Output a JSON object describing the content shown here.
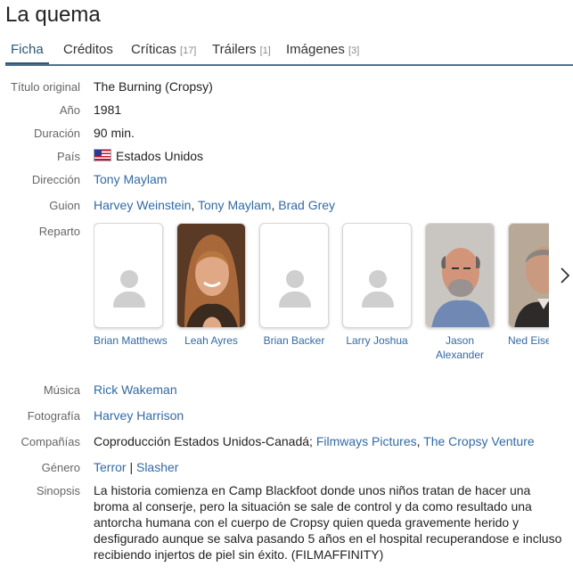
{
  "title": "La quema",
  "tabs": [
    {
      "label": "Ficha",
      "count": ""
    },
    {
      "label": "Créditos",
      "count": ""
    },
    {
      "label": "Críticas",
      "count": "[17]"
    },
    {
      "label": "Tráilers",
      "count": "[1]"
    },
    {
      "label": "Imágenes",
      "count": "[3]"
    }
  ],
  "details": {
    "original_title": {
      "label": "Título original",
      "value": "The Burning (Cropsy)"
    },
    "year": {
      "label": "Año",
      "value": "1981"
    },
    "duration": {
      "label": "Duración",
      "value": "90 min."
    },
    "country": {
      "label": "País",
      "value": "Estados Unidos",
      "flag_icon": "us-flag-icon"
    },
    "direction": {
      "label": "Dirección",
      "names": [
        "Tony Maylam"
      ]
    },
    "script": {
      "label": "Guion",
      "names": [
        "Harvey Weinstein",
        "Tony Maylam",
        "Brad Grey"
      ],
      "separator": ", "
    },
    "cast": {
      "label": "Reparto",
      "members": [
        {
          "name": "Brian Matthews",
          "photo": "placeholder"
        },
        {
          "name": "Leah Ayres",
          "photo": "woman-portrait"
        },
        {
          "name": "Brian Backer",
          "photo": "placeholder"
        },
        {
          "name": "Larry Joshua",
          "photo": "placeholder"
        },
        {
          "name": "Jason Alexander",
          "photo": "man-portrait-bald"
        },
        {
          "name": "Ned Eisenberg",
          "photo": "man-portrait-dark"
        }
      ]
    },
    "music": {
      "label": "Música",
      "names": [
        "Rick Wakeman"
      ]
    },
    "photography": {
      "label": "Fotografía",
      "names": [
        "Harvey Harrison"
      ]
    },
    "companies": {
      "label": "Compañías",
      "plain": "Coproducción Estados Unidos-Canadá; ",
      "names": [
        "Filmways Pictures",
        "The Cropsy Venture"
      ],
      "separator": ", "
    },
    "genre": {
      "label": "Género",
      "names": [
        "Terror",
        "Slasher"
      ],
      "separator": " | "
    },
    "synopsis": {
      "label": "Sinopsis",
      "text": "La historia comienza en Camp Blackfoot donde unos niños tratan de hacer una broma al conserje, pero la situación se sale de control y da como resultado una antorcha humana con el cuerpo de Cropsy quien queda gravemente herido y desfigurado aunque se salva pasando 5 años en el hospital recuperandose e incluso recibiendo injertos de piel sin éxito. (FILMAFFINITY)"
    }
  },
  "colors": {
    "link": "#326aa4",
    "tab_active": "#2d5677",
    "tab_rule": "#4b7292",
    "label": "#666666"
  },
  "icons": {
    "next": "chevron-right-icon",
    "placeholder": "person-placeholder-icon"
  }
}
